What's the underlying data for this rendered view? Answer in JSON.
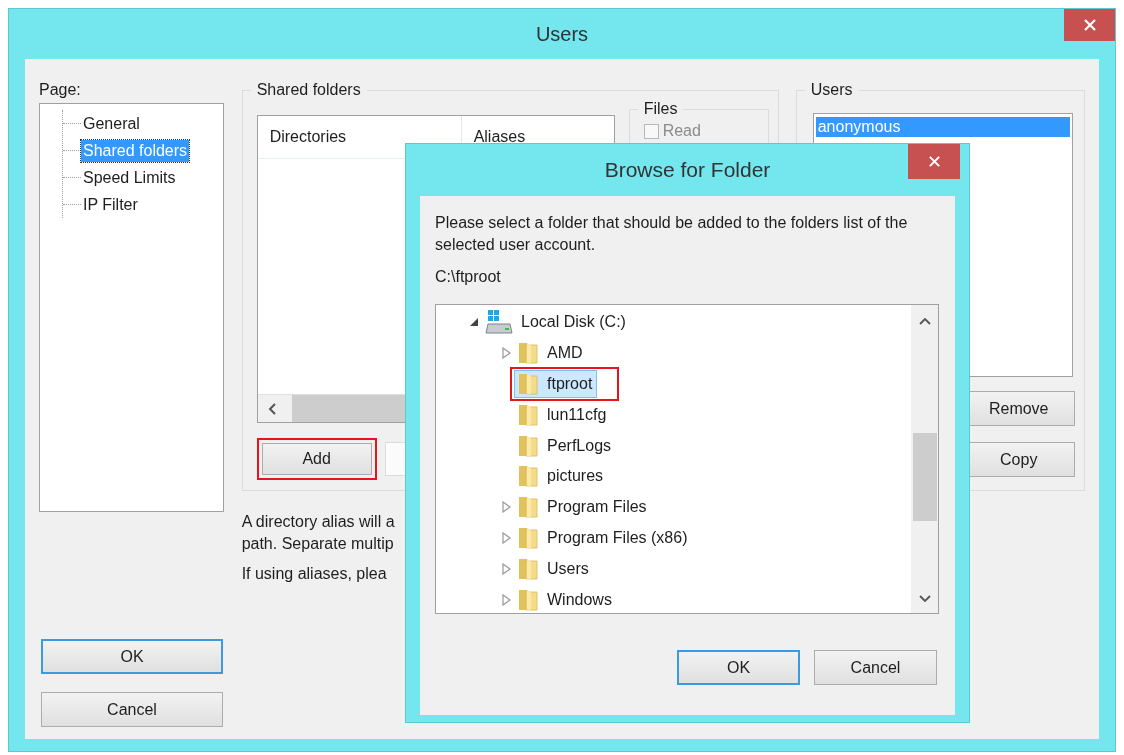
{
  "window": {
    "title": "Users"
  },
  "page_panel": {
    "label": "Page:",
    "items": [
      {
        "label": "General",
        "selected": false
      },
      {
        "label": "Shared folders",
        "selected": true
      },
      {
        "label": "Speed Limits",
        "selected": false
      },
      {
        "label": "IP Filter",
        "selected": false
      }
    ]
  },
  "shared_folders": {
    "title": "Shared folders",
    "columns": [
      "Directories",
      "Aliases"
    ],
    "files_group": {
      "title": "Files",
      "checkboxes": [
        {
          "label": "Read",
          "checked": false,
          "disabled": true
        }
      ]
    },
    "add_button": {
      "label": "Add",
      "highlighted": true
    }
  },
  "help_lines": [
    "A directory alias will a",
    "path. Separate multip",
    "If using aliases, plea"
  ],
  "users": {
    "title": "Users",
    "items": [
      {
        "label": "anonymous",
        "selected": true
      }
    ],
    "buttons": [
      {
        "label": "Remove"
      },
      {
        "label": "Copy"
      }
    ]
  },
  "dialog_buttons": [
    {
      "label": "OK",
      "default": true
    },
    {
      "label": "Cancel",
      "default": false
    }
  ],
  "browse_dialog": {
    "title": "Browse for Folder",
    "instruction": "Please select a folder that should be added to the folders list of the selected user account.",
    "path": "C:\\ftproot",
    "tree": [
      {
        "label": "Local Disk (C:)",
        "kind": "drive",
        "has_children": true,
        "expanded": true,
        "selected": false,
        "highlighted": false,
        "children": [
          {
            "label": "AMD",
            "kind": "folder",
            "has_children": true,
            "expanded": false,
            "selected": false,
            "highlighted": false
          },
          {
            "label": "ftproot",
            "kind": "folder",
            "has_children": false,
            "expanded": false,
            "selected": true,
            "highlighted": true
          },
          {
            "label": "lun11cfg",
            "kind": "folder",
            "has_children": false,
            "expanded": false,
            "selected": false,
            "highlighted": false
          },
          {
            "label": "PerfLogs",
            "kind": "folder",
            "has_children": false,
            "expanded": false,
            "selected": false,
            "highlighted": false
          },
          {
            "label": "pictures",
            "kind": "folder",
            "has_children": false,
            "expanded": false,
            "selected": false,
            "highlighted": false
          },
          {
            "label": "Program Files",
            "kind": "folder",
            "has_children": true,
            "expanded": false,
            "selected": false,
            "highlighted": false
          },
          {
            "label": "Program Files (x86)",
            "kind": "folder",
            "has_children": true,
            "expanded": false,
            "selected": false,
            "highlighted": false
          },
          {
            "label": "Users",
            "kind": "folder",
            "has_children": true,
            "expanded": false,
            "selected": false,
            "highlighted": false
          },
          {
            "label": "Windows",
            "kind": "folder",
            "has_children": true,
            "expanded": false,
            "selected": false,
            "highlighted": false
          }
        ]
      }
    ],
    "buttons": [
      {
        "label": "OK",
        "default": true
      },
      {
        "label": "Cancel",
        "default": false
      }
    ]
  }
}
